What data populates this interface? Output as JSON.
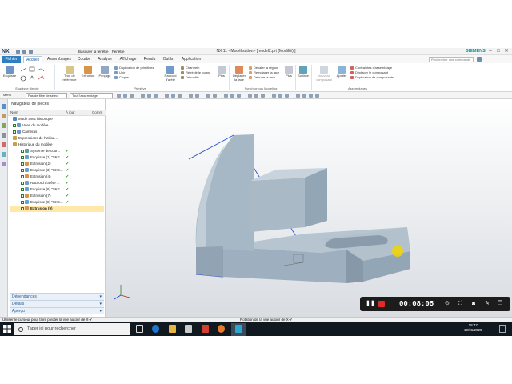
{
  "titlebar": {
    "logo": "NX",
    "quick_access": [
      "Basculer la fenêtre",
      "Fenêtre"
    ],
    "title": "NX 11 - Modélisation - [model2.prt (Modifié) ]",
    "brand": "SIEMENS",
    "controls": [
      "–",
      "□",
      "✕"
    ]
  },
  "menu": {
    "file": "Fichier",
    "tabs": [
      "Accueil",
      "Assemblages",
      "Courbe",
      "Analyse",
      "Affichage",
      "Rendu",
      "Outils",
      "Application"
    ],
    "active_tab": "Accueil",
    "search_placeholder": "Rechercher une commande"
  },
  "ribbon": {
    "sketch_btn": "Esquisse",
    "sketch_group": "Esquisse directe",
    "hole": "Trou de référence",
    "extrude": "Extrusion",
    "fillet": "Perçage",
    "primitive_items": [
      "Duplication de primitives",
      "Unir",
      "Coque"
    ],
    "primitive_group": "Primitive",
    "blend": "Raccord d'arête",
    "blend_items": [
      "Chanfrein",
      "Rétréciir le corps",
      "Dépouille"
    ],
    "more": "Plus",
    "move_face": "Déplacer la face",
    "sync_items": [
      "Décaler la région",
      "Remplacer la face",
      "Détruire la face"
    ],
    "sync_group": "Synchronous Modeling",
    "more2": "Plus",
    "surface": "Surface",
    "new_comp": "Nouveau composant",
    "add": "Ajouter",
    "asm_items": [
      "Contraintes d'assemblage",
      "Déplacer le composant",
      "Duplication de composants"
    ],
    "asm_group": "Assemblages"
  },
  "selbar": {
    "menu": "Menu",
    "filter": "Pas de filtre de sélec",
    "scope": "Tout l'assemblage"
  },
  "navigator": {
    "title": "Navigateur de pièces",
    "columns": [
      "Nom",
      "À jour",
      "Comm"
    ],
    "rows": [
      {
        "label": "Mode avec historique",
        "ok": false
      },
      {
        "label": "Vues du modèle",
        "ok": false
      },
      {
        "label": "Caméras",
        "ok": false
      },
      {
        "label": "Expressions de l'utilisa...",
        "ok": false
      },
      {
        "label": "Historique du modèle",
        "ok": false
      },
      {
        "label": "Système de coor...",
        "ok": true
      },
      {
        "label": "Esquisse (1) \"SKE...",
        "ok": true
      },
      {
        "label": "Extrusion (2)",
        "ok": true
      },
      {
        "label": "Esquisse (3) \"SKE...",
        "ok": true
      },
      {
        "label": "Extrusion (4)",
        "ok": true
      },
      {
        "label": "Raccord d'arête ...",
        "ok": true
      },
      {
        "label": "Esquisse (6) \"SKE...",
        "ok": true
      },
      {
        "label": "Extrusion (7)",
        "ok": true
      },
      {
        "label": "Esquisse (8) \"SKE...",
        "ok": true
      },
      {
        "label": "Extrusion (9)",
        "ok": false
      }
    ],
    "check_mark": "✔",
    "panels": [
      "Dépendances",
      "Détails",
      "Aperçu"
    ]
  },
  "recorder": {
    "time": "00:08:05"
  },
  "status": {
    "left": "Utiliser le curseur pour faire pivoter la vue autour de X-Y",
    "mid": "Rotation de la vue autour de X-Y"
  },
  "taskbar": {
    "search": "Taper ici pour rechercher",
    "time": "18:47",
    "date": "10/06/2020"
  },
  "colors": {
    "accent": "#2d7fc1",
    "part_face": "#9fb3c3",
    "highlight": "#f2d400"
  }
}
